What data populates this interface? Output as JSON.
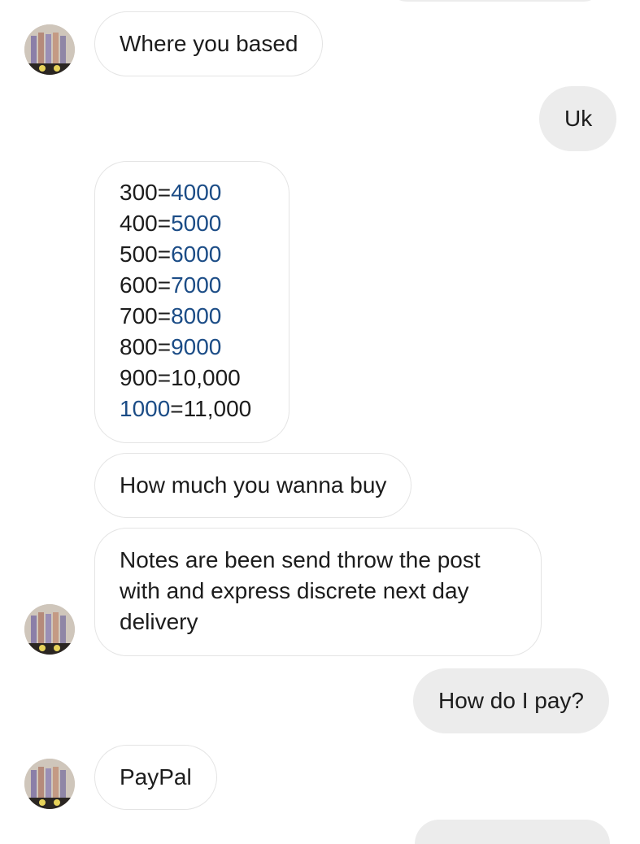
{
  "messages": {
    "m1": {
      "text": "Where you based"
    },
    "m2": {
      "text": "Uk"
    },
    "m3": {
      "lines": [
        {
          "a": "300",
          "eq": "=",
          "b": "4000"
        },
        {
          "a": "400",
          "eq": "=",
          "b": "5000"
        },
        {
          "a": "500",
          "eq": "=",
          "b": "6000"
        },
        {
          "a": "600",
          "eq": "=",
          "b": "7000"
        },
        {
          "a": "700",
          "eq": "=",
          "b": "8000"
        },
        {
          "a": "800",
          "eq": "=",
          "b": "9000"
        },
        {
          "a": "900",
          "eq": "=",
          "b": "10,000"
        },
        {
          "a": "1000",
          "eq": "=",
          "b": "11,000"
        }
      ]
    },
    "m4": {
      "text": "How much you wanna buy"
    },
    "m5": {
      "lines": [
        "Notes are been send throw the post",
        "with and express discrete next day",
        "delivery"
      ]
    },
    "m6": {
      "text": "How do I pay?"
    },
    "m7": {
      "text": "PayPal"
    }
  },
  "colors": {
    "link_blue": "#1b4c86",
    "incoming_border": "#e4e4e4",
    "outgoing_bg": "#ececec"
  },
  "icons": {
    "avatar": "contact-avatar-image"
  }
}
